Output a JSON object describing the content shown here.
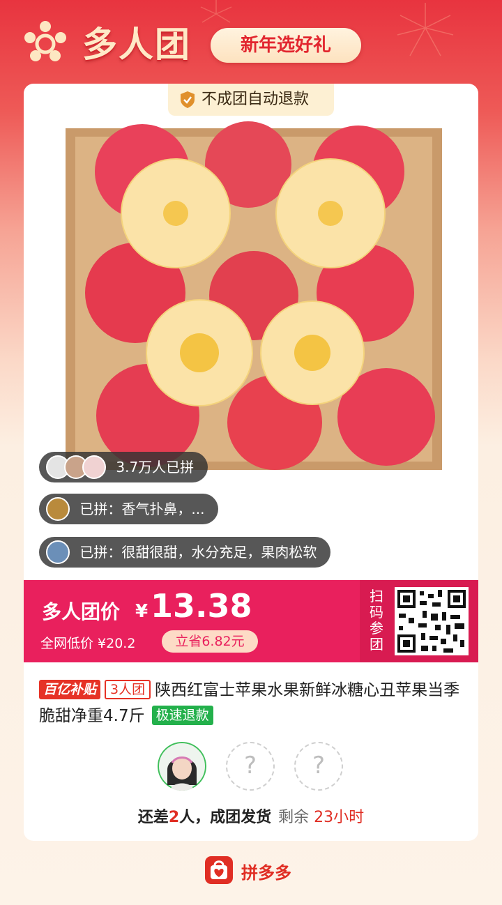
{
  "header": {
    "title": "多人团",
    "slogan": "新年选好礼"
  },
  "card": {
    "guarantee": "不成团自动退款",
    "bubbles": [
      {
        "text": "3.7万人已拼"
      },
      {
        "text": "已拼：香气扑鼻，..."
      },
      {
        "text": "已拼：很甜很甜，水分充足，果肉松软"
      }
    ],
    "price": {
      "label": "多人团价",
      "currency": "¥",
      "value": "13.38",
      "low_price": "全网低价 ¥20.2",
      "save": "立省6.82元",
      "qr_label": "扫码参团"
    },
    "product": {
      "tag_subsidy": "百亿补贴",
      "tag_group": "3人团",
      "title": "陕西红富士苹果水果新鲜冰糖心丑苹果当季脆甜净重4.7斤",
      "tag_refund": "极速退款"
    },
    "members": {
      "empty_mark": "?"
    },
    "status": {
      "prefix": "还差",
      "count": "2",
      "suffix": "人，成团发货",
      "remain_label": "剩余",
      "remain_time": "23小时"
    }
  },
  "footer": {
    "brand": "拼多多"
  },
  "colors": {
    "brand_red": "#e02e24",
    "price_bar": "#e9205d",
    "refund_green": "#23b04b"
  }
}
